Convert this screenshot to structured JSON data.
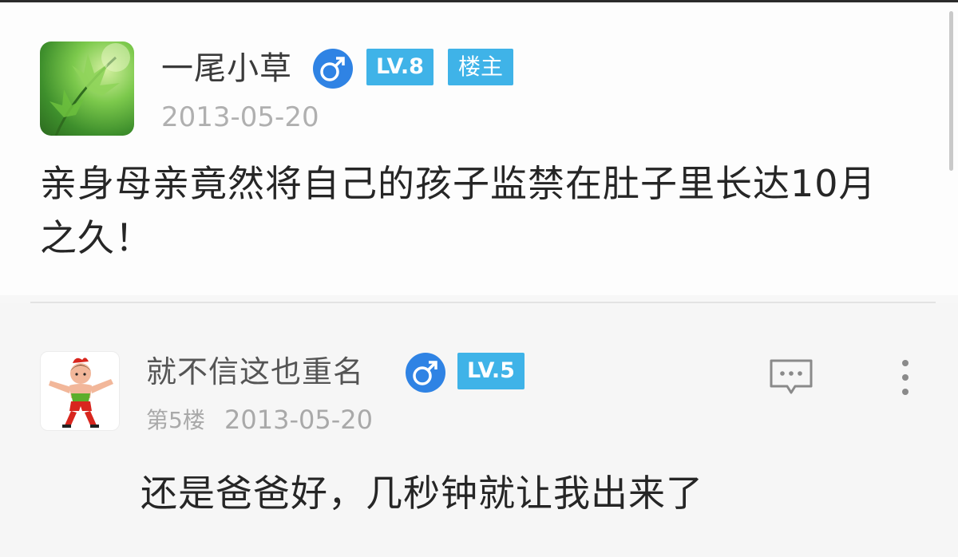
{
  "original_post": {
    "username": "一尾小草",
    "gender_icon": "male-icon",
    "level_badge": "LV.8",
    "op_badge": "楼主",
    "date": "2013-05-20",
    "content": "亲身母亲竟然将自己的孩子监禁在肚子里长达10月之久！"
  },
  "reply": {
    "username": "就不信这也重名",
    "gender_icon": "male-icon",
    "level_badge": "LV.5",
    "floor": "第5楼",
    "date": "2013-05-20",
    "content": "还是爸爸好，几秒钟就让我出来了"
  },
  "colors": {
    "badge_blue": "#3fb3e8",
    "gender_blue": "#2f83e4",
    "text_dark": "#262626",
    "text_gray": "#a9a9a9"
  }
}
